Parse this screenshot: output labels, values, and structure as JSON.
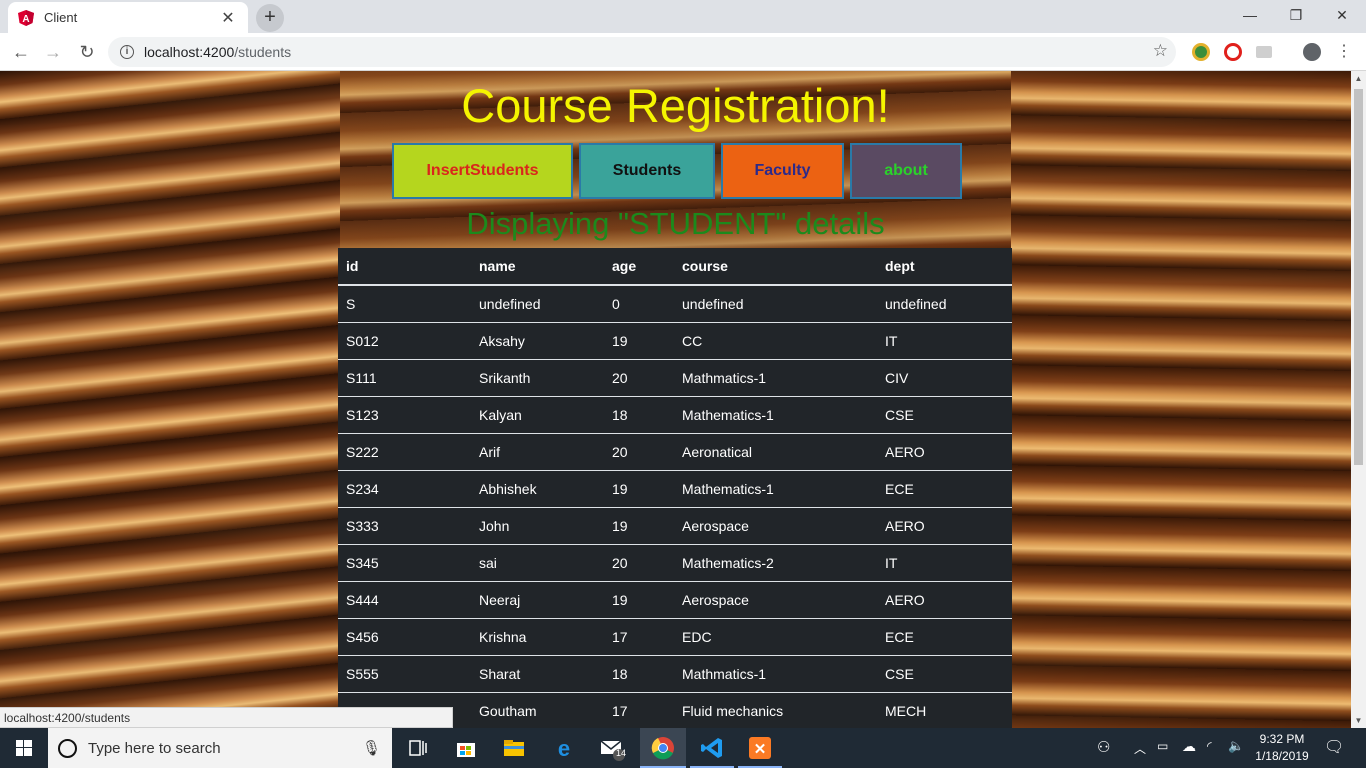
{
  "browser": {
    "tab_title": "Client",
    "url_host": "localhost:4200",
    "url_path": "/students",
    "status_url": "localhost:4200/students"
  },
  "app": {
    "title": "Course Registration!",
    "nav": [
      "InsertStudents",
      "Students",
      "Faculty",
      "about"
    ],
    "subtitle": "Displaying \"STUDENT\" details"
  },
  "table": {
    "headers": [
      "id",
      "name",
      "age",
      "course",
      "dept"
    ],
    "rows": [
      [
        "S",
        "undefined",
        "0",
        "undefined",
        "undefined"
      ],
      [
        "S012",
        "Aksahy",
        "19",
        "CC",
        "IT"
      ],
      [
        "S111",
        "Srikanth",
        "20",
        "Mathmatics-1",
        "CIV"
      ],
      [
        "S123",
        "Kalyan",
        "18",
        "Mathematics-1",
        "CSE"
      ],
      [
        "S222",
        "Arif",
        "20",
        "Aeronatical",
        "AERO"
      ],
      [
        "S234",
        "Abhishek",
        "19",
        "Mathematics-1",
        "ECE"
      ],
      [
        "S333",
        "John",
        "19",
        "Aerospace",
        "AERO"
      ],
      [
        "S345",
        "sai",
        "20",
        "Mathematics-2",
        "IT"
      ],
      [
        "S444",
        "Neeraj",
        "19",
        "Aerospace",
        "AERO"
      ],
      [
        "S456",
        "Krishna",
        "17",
        "EDC",
        "ECE"
      ],
      [
        "S555",
        "Sharat",
        "18",
        "Mathmatics-1",
        "CSE"
      ],
      [
        "",
        "Goutham",
        "17",
        "Fluid mechanics",
        "MECH"
      ]
    ]
  },
  "taskbar": {
    "search_placeholder": "Type here to search",
    "mail_badge": "14",
    "time": "9:32 PM",
    "date": "1/18/2019"
  }
}
